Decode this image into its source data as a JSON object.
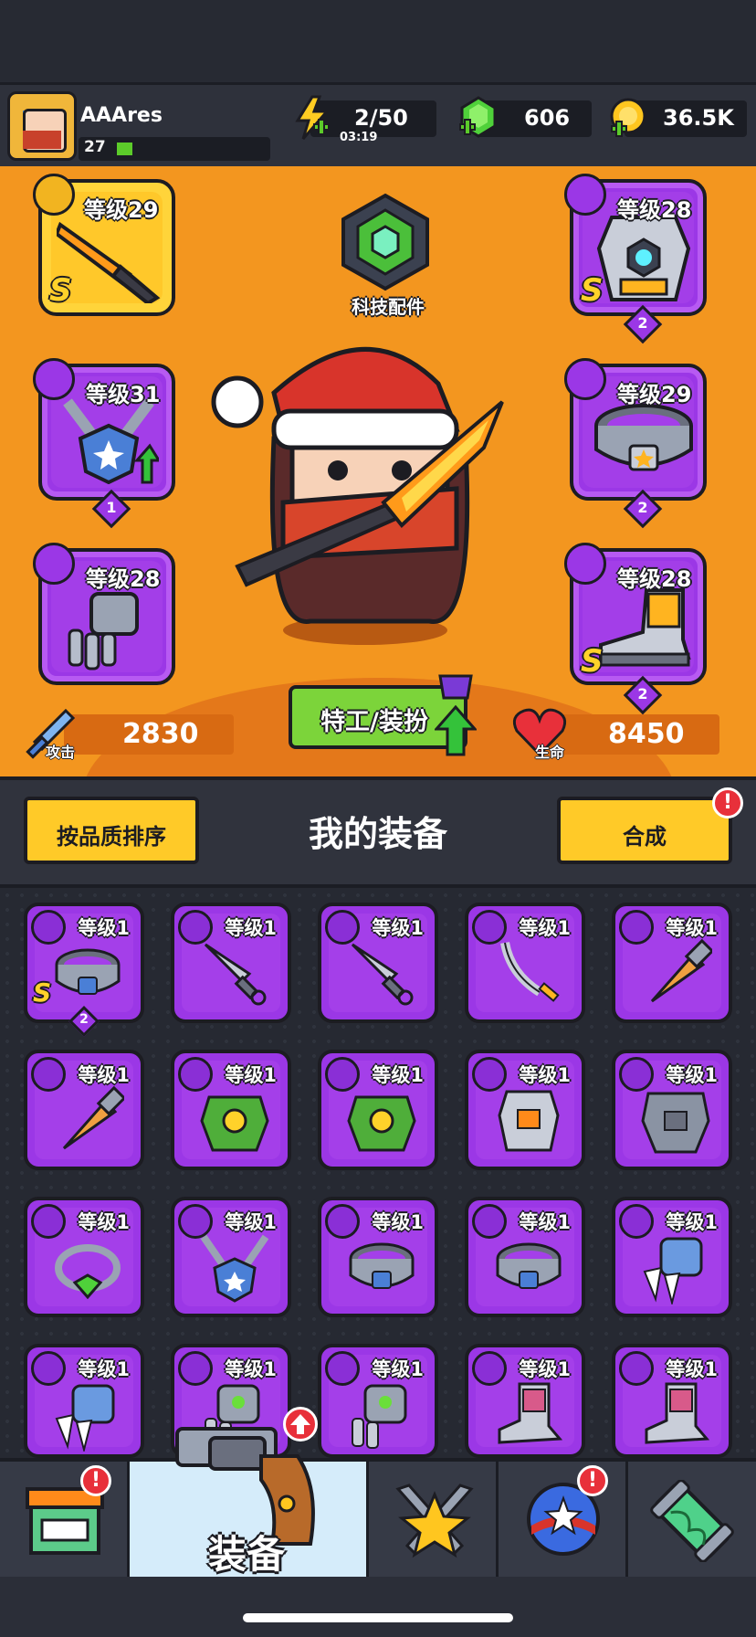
{
  "player": {
    "name": "AAAres",
    "level": "27",
    "xp_progress": 0.1
  },
  "resources": {
    "energy": {
      "value": "2/50",
      "timer": "03:19",
      "icon": "energy-bolt-icon"
    },
    "gems": {
      "value": "606",
      "icon": "green-gem-icon"
    },
    "coins": {
      "value": "36.5K",
      "icon": "gold-coin-icon"
    }
  },
  "equipped": {
    "weapon": {
      "level_label": "等级29",
      "rarity": "S",
      "icon": "sword-icon"
    },
    "armor": {
      "level_label": "等级28",
      "rarity": "S",
      "stars": "2",
      "icon": "armor-icon"
    },
    "necklace": {
      "level_label": "等级31",
      "stars": "1",
      "icon": "necklace-icon"
    },
    "belt": {
      "level_label": "等级29",
      "stars": "2",
      "icon": "belt-icon"
    },
    "gloves": {
      "level_label": "等级28",
      "icon": "gloves-icon"
    },
    "boots": {
      "level_label": "等级28",
      "rarity": "S",
      "stars": "2",
      "icon": "boots-icon"
    }
  },
  "tech_parts": {
    "label": "科技配件"
  },
  "stats": {
    "attack": {
      "label": "攻击",
      "value": "2830"
    },
    "health": {
      "label": "生命",
      "value": "8450"
    }
  },
  "agent_button": {
    "label": "特工/装扮"
  },
  "section": {
    "sort_button": "按品质排序",
    "title": "我的装备",
    "merge_button": "合成",
    "alert": "!"
  },
  "inventory": [
    {
      "level": "等级1",
      "type": "belt",
      "rarity": "S",
      "stars": "2",
      "icon": "belt-icon"
    },
    {
      "level": "等级1",
      "type": "weapon",
      "icon": "kunai-icon"
    },
    {
      "level": "等级1",
      "type": "weapon",
      "icon": "kunai-icon"
    },
    {
      "level": "等级1",
      "type": "weapon",
      "icon": "katana-icon"
    },
    {
      "level": "等级1",
      "type": "weapon",
      "icon": "drill-icon"
    },
    {
      "level": "等级1",
      "type": "weapon",
      "icon": "drill-icon"
    },
    {
      "level": "等级1",
      "type": "armor",
      "icon": "leaf-armor-icon"
    },
    {
      "level": "等级1",
      "type": "armor",
      "icon": "leaf-armor-icon"
    },
    {
      "level": "等级1",
      "type": "armor",
      "icon": "vest-armor-icon"
    },
    {
      "level": "等级1",
      "type": "armor",
      "icon": "plate-armor-icon"
    },
    {
      "level": "等级1",
      "type": "necklace",
      "icon": "gem-ring-icon"
    },
    {
      "level": "等级1",
      "type": "necklace",
      "icon": "necklace-icon"
    },
    {
      "level": "等级1",
      "type": "belt",
      "icon": "belt-icon"
    },
    {
      "level": "等级1",
      "type": "belt",
      "icon": "belt-icon"
    },
    {
      "level": "等级1",
      "type": "gloves",
      "icon": "claw-glove-icon"
    },
    {
      "level": "等级1",
      "type": "gloves",
      "icon": "claw-glove-icon"
    },
    {
      "level": "等级1",
      "type": "gloves",
      "icon": "mech-glove-icon"
    },
    {
      "level": "等级1",
      "type": "gloves",
      "icon": "mech-glove-icon"
    },
    {
      "level": "等级1",
      "type": "boots",
      "icon": "boot-icon"
    },
    {
      "level": "等级1",
      "type": "boots",
      "icon": "boot-icon"
    }
  ],
  "nav": {
    "tabs": [
      {
        "icon": "shop-icon",
        "alert": "!"
      },
      {
        "icon": "revolver-icon",
        "label": "装备",
        "active": true
      },
      {
        "icon": "star-swords-icon"
      },
      {
        "icon": "star-orb-icon",
        "alert": "!"
      },
      {
        "icon": "dna-capsule-icon"
      }
    ]
  },
  "colors": {
    "accent_orange": "#f3961f",
    "rarity_purple": "#9b37e6",
    "rarity_gold": "#ffd43a",
    "button_green": "#7cd43a",
    "button_yellow": "#ffca28",
    "alert_red": "#e8303a"
  }
}
